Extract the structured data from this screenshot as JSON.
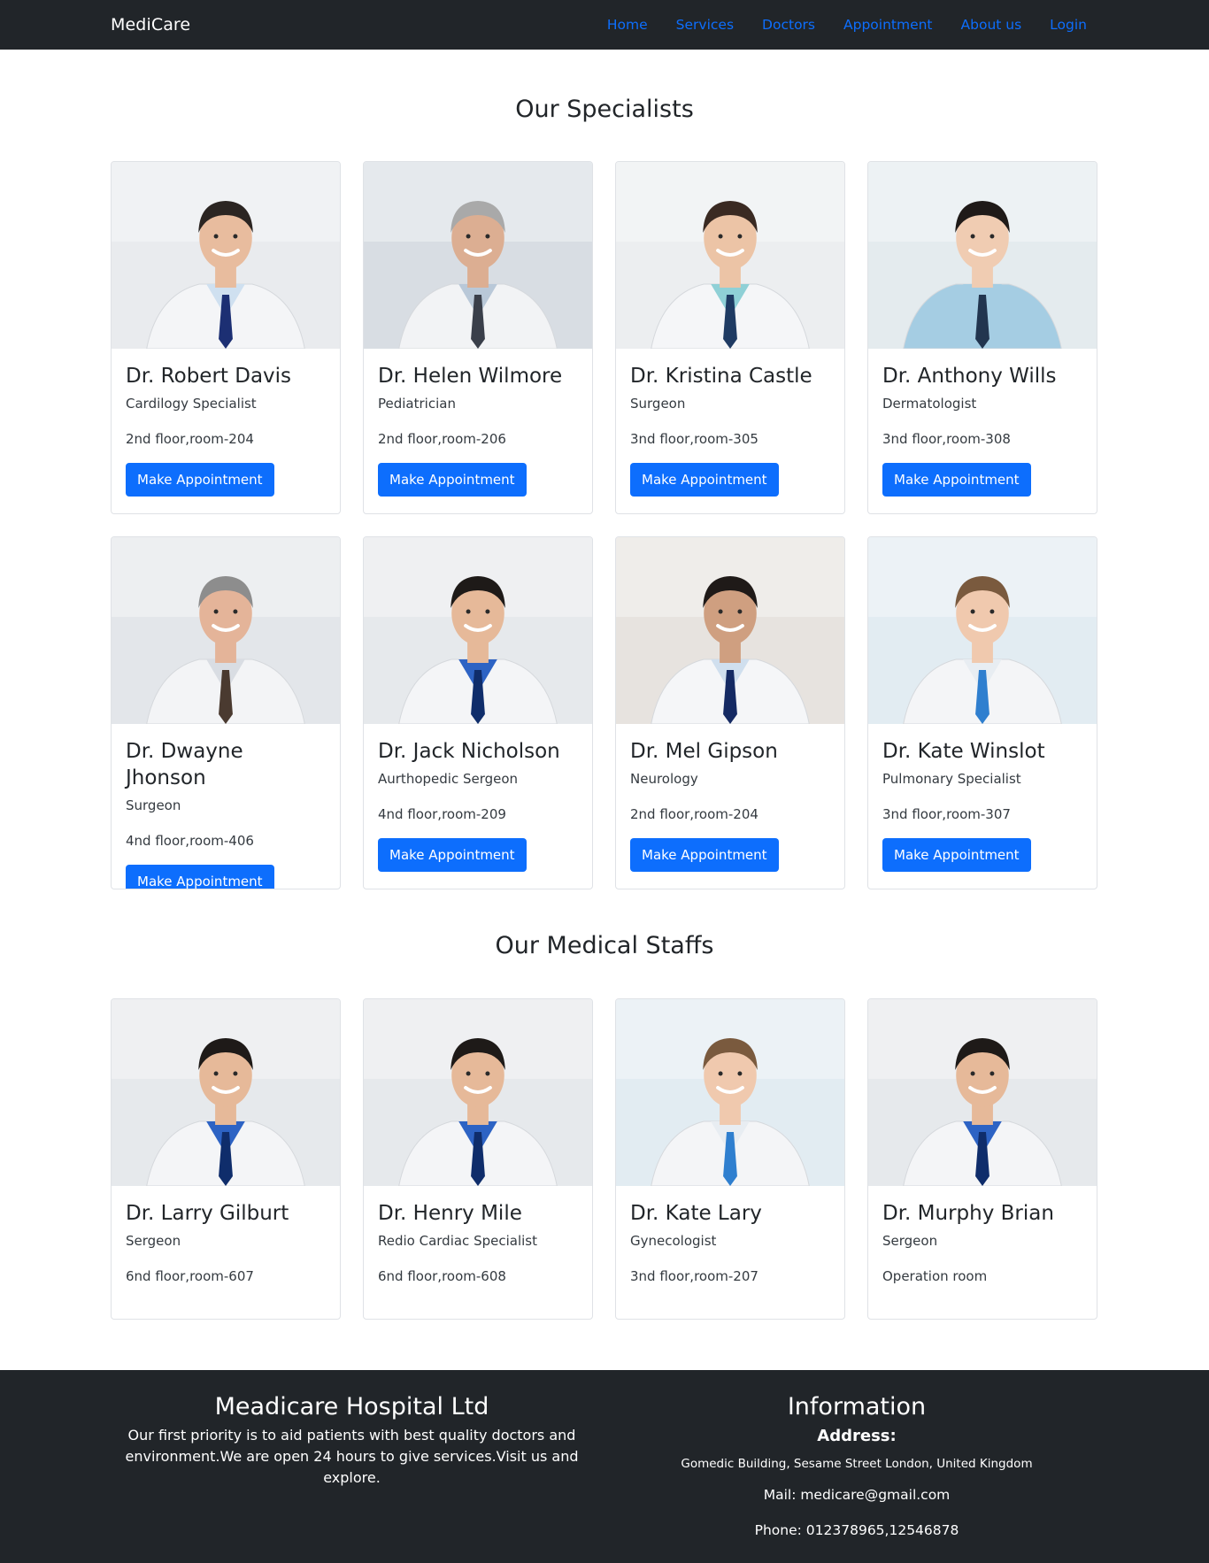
{
  "nav": {
    "brand": "MediCare",
    "links": [
      "Home",
      "Services",
      "Doctors",
      "Appointment",
      "About us",
      "Login"
    ]
  },
  "specialists": {
    "title": "Our Specialists",
    "button_label": "Make Appointment",
    "doctors": [
      {
        "name": "Dr. Robert Davis",
        "role": "Cardilogy Specialist",
        "room": "2nd floor,room-204"
      },
      {
        "name": "Dr. Helen Wilmore",
        "role": "Pediatrician",
        "room": "2nd floor,room-206"
      },
      {
        "name": "Dr. Kristina Castle",
        "role": "Surgeon",
        "room": "3nd floor,room-305"
      },
      {
        "name": "Dr. Anthony Wills",
        "role": "Dermatologist",
        "room": "3nd floor,room-308"
      },
      {
        "name": "Dr. Dwayne Jhonson",
        "role": "Surgeon",
        "room": "4nd floor,room-406"
      },
      {
        "name": "Dr. Jack Nicholson",
        "role": "Aurthopedic Sergeon",
        "room": "4nd floor,room-209"
      },
      {
        "name": "Dr. Mel Gipson",
        "role": "Neurology",
        "room": "2nd floor,room-204"
      },
      {
        "name": "Dr. Kate Winslot",
        "role": "Pulmonary Specialist",
        "room": "3nd floor,room-307"
      }
    ]
  },
  "staffs": {
    "title": "Our Medical Staffs",
    "members": [
      {
        "name": "Dr. Larry Gilburt",
        "role": "Sergeon",
        "room": "6nd floor,room-607"
      },
      {
        "name": "Dr. Henry Mile",
        "role": "Redio Cardiac Specialist",
        "room": "6nd floor,room-608"
      },
      {
        "name": "Dr. Kate Lary",
        "role": "Gynecologist",
        "room": "3nd floor,room-207"
      },
      {
        "name": "Dr. Murphy Brian",
        "role": "Sergeon",
        "room": "Operation room"
      }
    ]
  },
  "footer": {
    "left_title": "Meadicare Hospital Ltd",
    "left_text": "Our first priority is to aid patients with best quality doctors and environment.We are open 24 hours to give services.Visit us and explore.",
    "right_title": "Information",
    "address_label": "Address:",
    "address": "Gomedic Building, Sesame Street London, United Kingdom",
    "mail": "Mail: medicare@gmail.com",
    "phone": "Phone: 012378965,12546878"
  },
  "colors": {
    "nav_bg": "#212529",
    "link": "#0d6efd",
    "button": "#0d6efd",
    "footer_bg": "#212529"
  }
}
